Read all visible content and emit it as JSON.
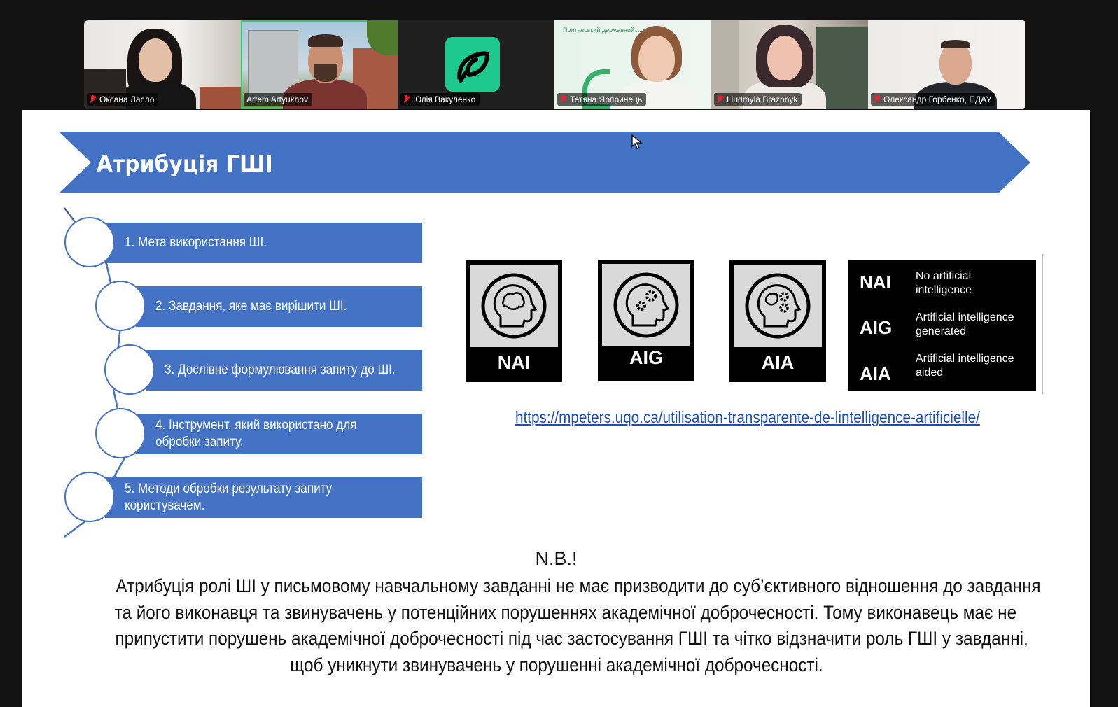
{
  "participants": [
    {
      "name": "Оксана Ласло",
      "muted": true,
      "active": false
    },
    {
      "name": "Artem Artyukhov",
      "muted": false,
      "active": true
    },
    {
      "name": "Юлія Вакуленко",
      "muted": true,
      "active": false
    },
    {
      "name": "Тетяна Ярпринець",
      "muted": true,
      "active": false,
      "background_text": "Полтавський державний ... рситет"
    },
    {
      "name": "Liudmyla Brazhnyk",
      "muted": true,
      "active": false
    },
    {
      "name": "Олександр Горбенко, ПДАУ",
      "muted": true,
      "active": false
    }
  ],
  "slide": {
    "title": "Атрибуція ГШІ",
    "steps": [
      {
        "label": "1. Мета використання ШІ."
      },
      {
        "label": "2. Завдання, яке має вирішити ШІ."
      },
      {
        "label": "3. Дослівне формулювання запиту до ШІ."
      },
      {
        "label": "4. Інструмент, який використано для обробки запиту."
      },
      {
        "label": "5. Методи обробки результату запиту користувачем."
      }
    ],
    "badges": [
      {
        "code": "NAI",
        "icon": "head-brain-icon"
      },
      {
        "code": "AIG",
        "icon": "head-gears-icon"
      },
      {
        "code": "AIA",
        "icon": "head-brain-gears-icon"
      }
    ],
    "legend": [
      {
        "code": "NAI",
        "desc": "No artificial intelligence"
      },
      {
        "code": "AIG",
        "desc": "Artificial intelligence generated"
      },
      {
        "code": "AIA",
        "desc": "Artificial intelligence aided"
      }
    ],
    "link": "https://mpeters.uqo.ca/utilisation-transparente-de-lintelligence-artificielle/",
    "nb_heading": "N.B.!",
    "nb_lines": [
      "Атрибуція ролі ШІ у письмовому навчальному завданні не має призводити до суб’єктивного відношення до завдання",
      "та його виконавця та звинувачень у потенційних порушеннях академічної доброчесності. Тому виконавець має не",
      "припустити порушень академічної доброчесності під час застосування ГШІ та чітко відзначити роль ГШІ у завданні,",
      "щоб уникнути звинувачень у порушенні академічної доброчесності."
    ]
  },
  "colors": {
    "accent_blue": "#4472c4",
    "link": "#1f4fb4",
    "active_speaker": "#2ec96a",
    "muted_mic": "#ee2233",
    "app_logo": "#1ec98f"
  }
}
